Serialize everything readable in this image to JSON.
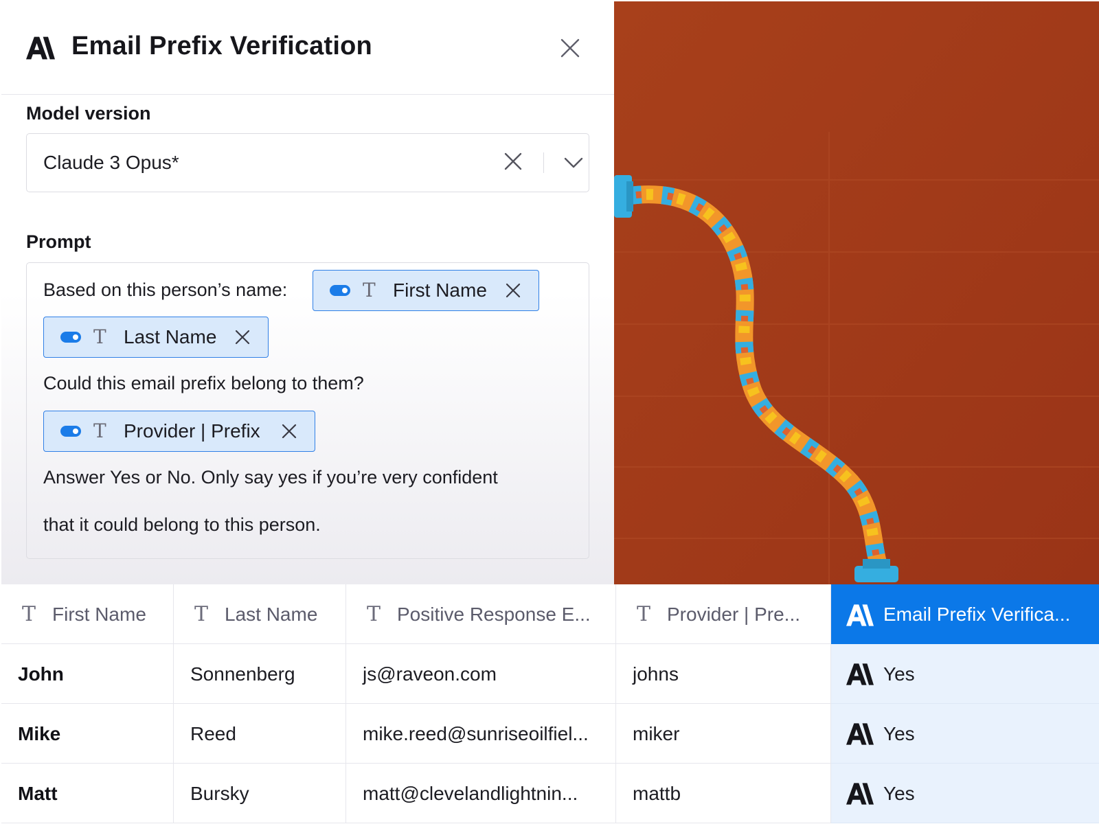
{
  "modal": {
    "title": "Email Prefix Verification",
    "model_label": "Model version",
    "model_value": "Claude 3 Opus*",
    "prompt_label": "Prompt",
    "prompt": {
      "line1": "Based on this person’s name:",
      "chip1": "First Name",
      "chip2": "Last Name",
      "line2": "Could this email prefix belong to them?",
      "chip3": "Provider | Prefix",
      "line3": "Answer Yes or No. Only say yes if you’re very confident",
      "line4": "that it could belong to this person."
    }
  },
  "table": {
    "columns": [
      "First Name",
      "Last Name",
      "Positive Response E...",
      "Provider | Pre...",
      "Email Prefix Verifica..."
    ],
    "rows": [
      [
        "John",
        "Sonnenberg",
        "js@raveon.com",
        "johns",
        "Yes"
      ],
      [
        "Mike",
        "Reed",
        "mike.reed@sunriseoilfiel...",
        "miker",
        "Yes"
      ],
      [
        "Matt",
        "Bursky",
        "matt@clevelandlightnin...",
        "mattb",
        "Yes"
      ]
    ]
  },
  "colors": {
    "accent": "#0b78e8",
    "chip_bg": "#d9e9fb",
    "art_bg": "#a23c1a",
    "ai_cell_bg": "#e9f2fd"
  },
  "icons": [
    "anthropic-logo-icon",
    "close-icon",
    "chevron-down-icon",
    "text-type-icon",
    "toggle-icon"
  ]
}
